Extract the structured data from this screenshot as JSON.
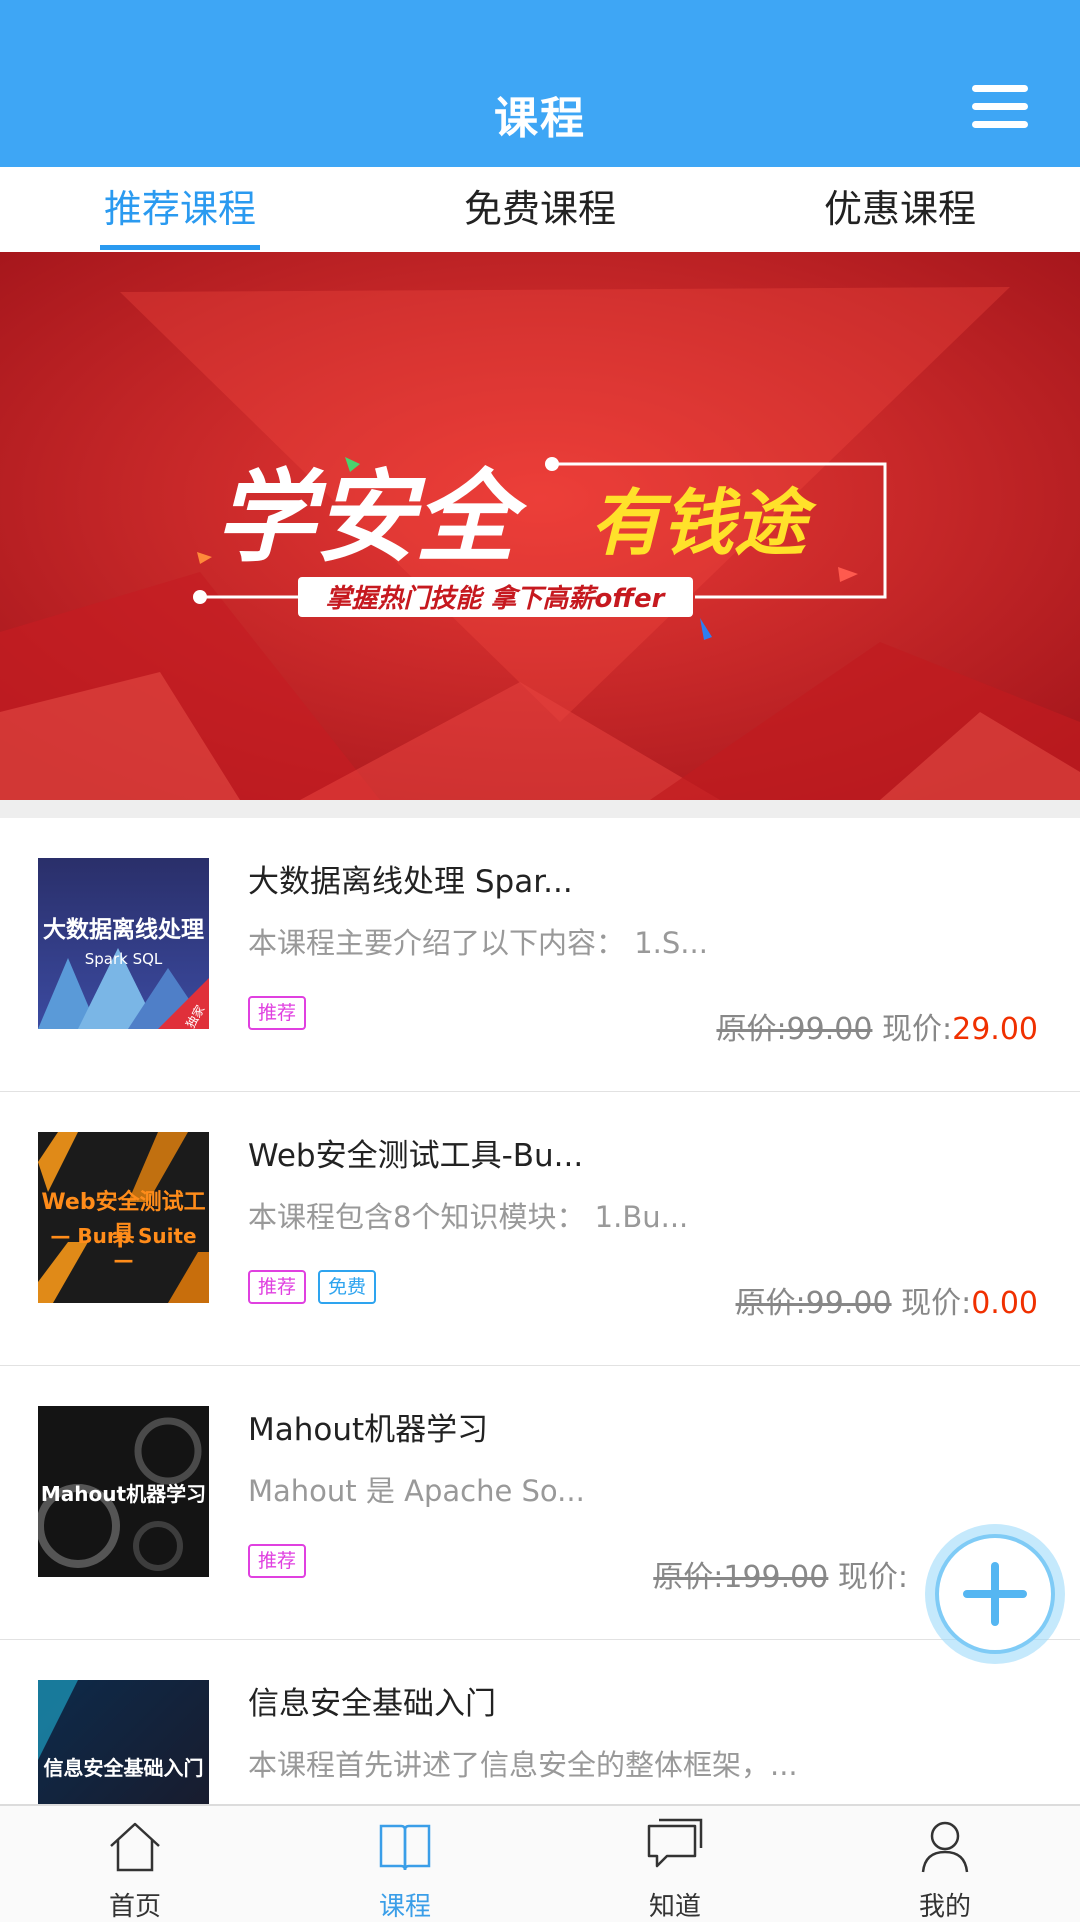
{
  "header": {
    "title": "课程",
    "menu_icon": "hamburger-menu-icon"
  },
  "tabs": [
    {
      "label": "推荐课程",
      "active": true
    },
    {
      "label": "免费课程",
      "active": false
    },
    {
      "label": "优惠课程",
      "active": false
    }
  ],
  "banner": {
    "headline_main": "学安全",
    "headline_accent": "有钱途",
    "subline": "掌握热门技能 拿下高薪offer",
    "colors": {
      "bg": "#d8262b",
      "accent": "#ffe12a"
    }
  },
  "courses": [
    {
      "thumb_text": "大数据离线处理",
      "thumb_sub": "Spark SQL",
      "thumb_badge": "独家",
      "title": "大数据离线处理 Spar...",
      "desc": "本课程主要介绍了以下内容： 1.S...",
      "tags": [
        "推荐"
      ],
      "orig_price": "原价:99.00",
      "cur_label": "现价:",
      "cur_price": "29.00"
    },
    {
      "thumb_text": "Web安全测试工具",
      "thumb_sub": "— Burp Suite —",
      "title": "Web安全测试工具-Bu...",
      "desc": "本课程包含8个知识模块： 1.Bu...",
      "tags": [
        "推荐",
        "免费"
      ],
      "orig_price": "原价:99.00",
      "cur_label": "现价:",
      "cur_price": "0.00"
    },
    {
      "thumb_text": "Mahout机器学习",
      "title": "Mahout机器学习",
      "desc": "Mahout 是 Apache So...",
      "tags": [
        "推荐"
      ],
      "orig_price": "原价:199.00",
      "cur_label": "现价:",
      "cur_price": ""
    },
    {
      "thumb_text": "信息安全基础入门",
      "title": "信息安全基础入门",
      "desc": "本课程首先讲述了信息安全的整体框架，...",
      "tags": []
    }
  ],
  "fab": {
    "icon": "plus-icon"
  },
  "bottom_nav": [
    {
      "label": "首页",
      "icon": "home-icon",
      "active": false
    },
    {
      "label": "课程",
      "icon": "book-icon",
      "active": true
    },
    {
      "label": "知道",
      "icon": "chat-icon",
      "active": false
    },
    {
      "label": "我的",
      "icon": "user-icon",
      "active": false
    }
  ],
  "colors": {
    "primary": "#3ea6f5",
    "price_red": "#f03000",
    "tag_pink": "#e040e0",
    "tag_blue": "#2ea4ef"
  }
}
